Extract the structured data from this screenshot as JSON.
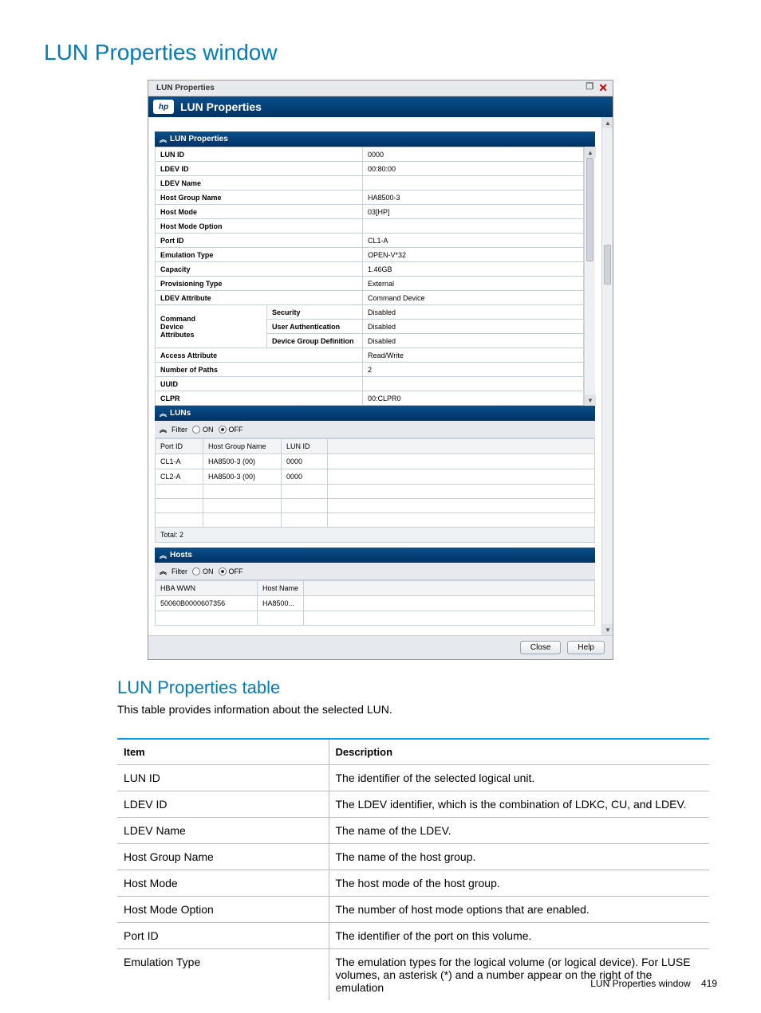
{
  "page": {
    "title": "LUN Properties window",
    "sub_title": "LUN Properties table",
    "sub_desc": "This table provides information about the selected LUN.",
    "foot_label": "LUN Properties window",
    "foot_page": "419"
  },
  "window": {
    "topbar_title": "LUN Properties",
    "header_title": "LUN Properties",
    "section_properties": "LUN Properties",
    "section_luns": "LUNs",
    "section_hosts": "Hosts",
    "filter_label": "Filter",
    "filter_on": "ON",
    "filter_off": "OFF",
    "btn_close": "Close",
    "btn_help": "Help",
    "hp_glyph": "hp"
  },
  "props": {
    "rows": [
      {
        "label": "LUN ID",
        "value": "0000"
      },
      {
        "label": "LDEV ID",
        "value": "00:80:00"
      },
      {
        "label": "LDEV Name",
        "value": ""
      },
      {
        "label": "Host Group Name",
        "value": "HA8500-3"
      },
      {
        "label": "Host Mode",
        "value": "03[HP]"
      },
      {
        "label": "Host Mode Option",
        "value": ""
      },
      {
        "label": "Port ID",
        "value": "CL1-A"
      },
      {
        "label": "Emulation Type",
        "value": "OPEN-V*32"
      },
      {
        "label": "Capacity",
        "value": "1.46GB"
      },
      {
        "label": "Provisioning Type",
        "value": "External"
      },
      {
        "label": "LDEV Attribute",
        "value": "Command Device"
      }
    ],
    "cmd": {
      "left": [
        "Command",
        "Device",
        "Attributes"
      ],
      "mid": [
        "Security",
        "User Authentication",
        "Device Group Definition"
      ],
      "vals": [
        "Disabled",
        "Disabled",
        "Disabled"
      ]
    },
    "tail": [
      {
        "label": "Access Attribute",
        "value": "Read/Write"
      },
      {
        "label": "Number of Paths",
        "value": "2"
      },
      {
        "label": "UUID",
        "value": ""
      },
      {
        "label": "CLPR",
        "value": "00:CLPR0"
      }
    ]
  },
  "luns": {
    "cols": [
      "Port ID",
      "Host Group Name",
      "LUN ID"
    ],
    "rows": [
      [
        "CL1-A",
        "HA8500-3 (00)",
        "0000"
      ],
      [
        "CL2-A",
        "HA8500-3 (00)",
        "0000"
      ]
    ],
    "total": "Total: 2"
  },
  "hosts": {
    "cols": [
      "HBA WWN",
      "Host Name"
    ],
    "row": [
      "50060B0000607356",
      "HA8500..."
    ]
  },
  "desc_table": {
    "headers": [
      "Item",
      "Description"
    ],
    "rows": [
      [
        "LUN ID",
        "The identifier of the selected logical unit."
      ],
      [
        "LDEV ID",
        "The LDEV identifier, which is the combination of LDKC, CU, and LDEV."
      ],
      [
        "LDEV Name",
        "The name of the LDEV."
      ],
      [
        "Host Group Name",
        "The name of the host group."
      ],
      [
        "Host Mode",
        "The host mode of the host group."
      ],
      [
        "Host Mode Option",
        "The number of host mode options that are enabled."
      ],
      [
        "Port ID",
        "The identifier of the port on this volume."
      ],
      [
        "Emulation Type",
        "The emulation types for the logical volume (or logical device). For LUSE volumes, an asterisk (*) and a number appear on the right of the emulation"
      ]
    ]
  }
}
